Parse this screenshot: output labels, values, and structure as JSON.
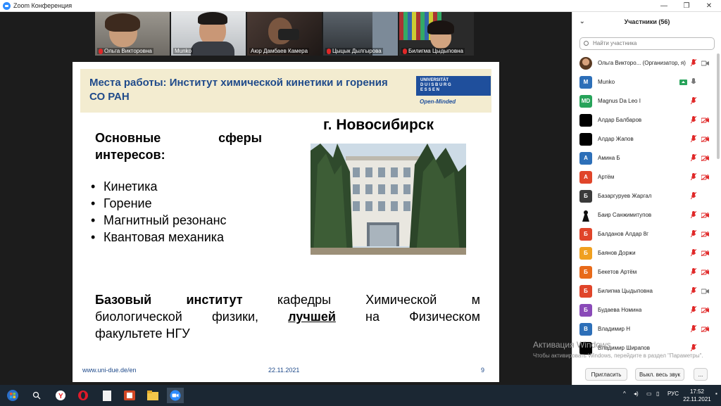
{
  "window": {
    "title": "Zoom Конференция"
  },
  "thumbnails": [
    {
      "name": "Ольга Викторовна",
      "muted": true
    },
    {
      "name": "Munko",
      "muted": false,
      "active": true
    },
    {
      "name": "Аюр Дамбаев Камера",
      "muted": false
    },
    {
      "name": "Цыцык Дылгырова",
      "muted": true
    },
    {
      "name": "Билигма Цыдыповна",
      "muted": true
    }
  ],
  "slide": {
    "title": "Места работы: Институт химической кинетики и горения СО РАН",
    "logo": {
      "line1": "UNIVERSITÄT",
      "line2": "D U I S B U R G",
      "line3": "E S S E N",
      "tagline": "Open-Minded"
    },
    "interests_heading_w1": "Основные",
    "interests_heading_w2": "сферы",
    "interests_heading_line2": "интересов:",
    "bullets": [
      "Кинетика",
      "Горение",
      "Магнитный резонанс",
      "Квантовая механика"
    ],
    "city": "г. Новосибирск",
    "bottom": {
      "bold1": "Базовый",
      "bold2": "институт",
      "rest1": "кафедры Химической м",
      "line2a": "биологической физики,",
      "line2b": "лучшей",
      "line2c": "на Физическом",
      "line3": "факультете НГУ"
    },
    "footer_url": "www.uni-due.de/en",
    "footer_date": "22.11.2021",
    "footer_page": "9"
  },
  "panel": {
    "title": "Участники (56)",
    "search_placeholder": "Найти участника",
    "participants": [
      {
        "initials": "",
        "name": "Ольга Викторо... (Организатор, я)",
        "color": "#7a5a3a",
        "photo": true,
        "mic": "off",
        "cam": "on"
      },
      {
        "initials": "M",
        "name": "Munko",
        "color": "#2d6fb8",
        "mic": "on",
        "cam": "share"
      },
      {
        "initials": "MD",
        "name": "Magnus Da Leo I",
        "color": "#27a35a",
        "mic": "off",
        "cam": "none"
      },
      {
        "initials": "",
        "name": "Алдар Балбаров",
        "color": "#000000",
        "mic": "off",
        "cam": "off"
      },
      {
        "initials": "",
        "name": "Алдар Жапов",
        "color": "#000000",
        "mic": "off",
        "cam": "off"
      },
      {
        "initials": "А",
        "name": "Амина Б",
        "color": "#2d6fb8",
        "mic": "off",
        "cam": "off"
      },
      {
        "initials": "А",
        "name": "Артём",
        "color": "#e0452a",
        "mic": "off",
        "cam": "off"
      },
      {
        "initials": "Б",
        "name": "Базаргуруев Жаргал",
        "color": "#3a3a3a",
        "mic": "off",
        "cam": "none"
      },
      {
        "initials": "",
        "name": "Баир Санжимитупов",
        "color": "#ffffff",
        "photo2": true,
        "mic": "off",
        "cam": "off"
      },
      {
        "initials": "Б",
        "name": "Балданов Алдар 8г",
        "color": "#e0452a",
        "mic": "off",
        "cam": "off"
      },
      {
        "initials": "Б",
        "name": "Баянов Доржи",
        "color": "#f0a020",
        "mic": "off",
        "cam": "off"
      },
      {
        "initials": "Б",
        "name": "Бекетов Артём",
        "color": "#e86a1a",
        "mic": "off",
        "cam": "off"
      },
      {
        "initials": "Б",
        "name": "Билигма Цыдыповна",
        "color": "#e0452a",
        "mic": "off",
        "cam": "on"
      },
      {
        "initials": "Б",
        "name": "Будаева Номина",
        "color": "#8a4ab8",
        "mic": "off",
        "cam": "off"
      },
      {
        "initials": "В",
        "name": "Владимир Н",
        "color": "#2d6fb8",
        "mic": "off",
        "cam": "off"
      },
      {
        "initials": "",
        "name": "Владимир Ширапов",
        "color": "#000000",
        "mic": "off",
        "cam": "none"
      }
    ],
    "buttons": {
      "invite": "Пригласить",
      "mute_all": "Выкл. весь звук",
      "more": "..."
    }
  },
  "watermark": {
    "title": "Активация Windows",
    "text": "Чтобы активировать Windows, перейдите в раздел \"Параметры\"."
  },
  "taskbar": {
    "lang": "РУС",
    "time": "17:52",
    "date": "22.11.2021"
  }
}
